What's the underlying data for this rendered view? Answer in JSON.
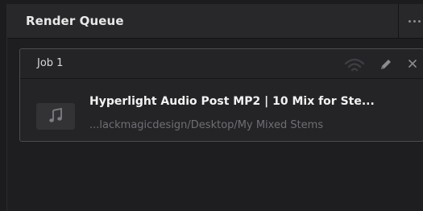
{
  "panel": {
    "title": "Render Queue",
    "more_icon": "more-horizontal-icon"
  },
  "job": {
    "title": "Job 1",
    "icons": {
      "status": "wifi-icon",
      "edit": "pencil-icon",
      "remove": "close-icon"
    },
    "thumbnail_icon": "music-note-icon",
    "clip_name": "Hyperlight Audio Post MP2 | 10 Mix for Ste...",
    "clip_path": "...lackmagicdesign/Desktop/My Mixed Stems"
  },
  "colors": {
    "background": "#1e1e21",
    "header": "#28282b",
    "card_border": "#4c4c50",
    "title_text": "#e8e8e8",
    "path_text": "#6f6f73"
  }
}
